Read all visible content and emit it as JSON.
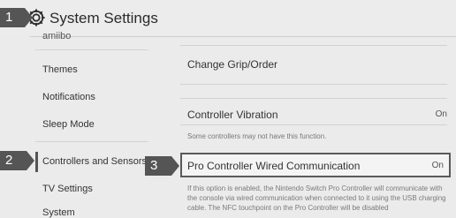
{
  "header": {
    "title": "System Settings",
    "icon": "gear-icon",
    "cut_text": "amiibo"
  },
  "badges": [
    "1",
    "2",
    "3"
  ],
  "sidebar": {
    "items": [
      {
        "label": "Themes"
      },
      {
        "label": "Notifications"
      },
      {
        "label": "Sleep Mode"
      },
      {
        "label": "Controllers and Sensors"
      },
      {
        "label": "TV Settings"
      },
      {
        "label": "System"
      }
    ],
    "selected": "Controllers and Sensors"
  },
  "content": {
    "rows": [
      {
        "label": "Change Grip/Order",
        "value": ""
      },
      {
        "label": "Controller Vibration",
        "value": "On",
        "note": "Some controllers may not have this function."
      },
      {
        "label": "Pro Controller Wired Communication",
        "value": "On",
        "note": "If this option is enabled, the Nintendo Switch Pro Controller will communicate with the console via wired communication when connected to it using the USB charging cable. The NFC touchpoint on the Pro Controller will be disabled"
      }
    ]
  },
  "colors": {
    "badge": "#555555",
    "background": "#ebebeb",
    "focus_border": "#5a5a5a"
  }
}
